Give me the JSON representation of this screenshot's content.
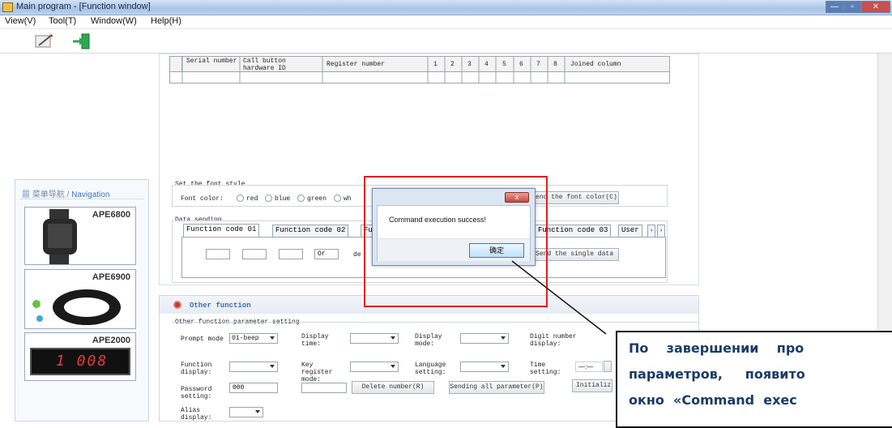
{
  "window": {
    "title": "Main program - [Function window]",
    "min": "—",
    "max": "▫",
    "close": "✕"
  },
  "menu": [
    "View(V)",
    "Tool(T)",
    "Window(W)",
    "Help(H)"
  ],
  "nav": {
    "title_cn": "菜单导航",
    "title_en": "Navigation",
    "products": [
      "APE6800",
      "APE6900",
      "APE2000"
    ],
    "display_value": "1 008"
  },
  "table": {
    "headers": [
      "Serial number",
      "Call button hardware ID",
      "Register number",
      "1",
      "2",
      "3",
      "4",
      "5",
      "6",
      "7",
      "8",
      "Joined column"
    ]
  },
  "font_style": {
    "title": "Set the font style",
    "label": "Font color:",
    "options": [
      "red",
      "blue",
      "green",
      "wh"
    ],
    "button": "Send the font color(C)"
  },
  "data_sending": {
    "title": "Data sending",
    "tabs": [
      "Function code 01",
      "Function code 02",
      "Fu",
      "Function code 03",
      "User"
    ],
    "field_or": "Or",
    "field_de": "de",
    "button": "Send the single data"
  },
  "dialog": {
    "message": "Command execution success!",
    "ok": "确定",
    "close": "x"
  },
  "other": {
    "title": "Other function",
    "group": "Other function parameter setting",
    "prompt_mode_label": "Prompt mode",
    "prompt_mode_value": "01-beep",
    "display_time_label": "Display time:",
    "display_mode_label": "Display mode:",
    "digit_number_label": "Digit number display:",
    "function_display_label": "Function display:",
    "key_register_label": "Key register mode:",
    "language_label": "Language setting:",
    "time_setting_label": "Time setting:",
    "time_value": "—:—",
    "password_label": "Password setting:",
    "password_value": "000",
    "delete_button": "Delete number(R)",
    "send_all_button": "Sending all parameter(P)",
    "init_button": "Initializ",
    "alias_label": "Alias display:"
  },
  "callout": {
    "lines": [
      "По    завершении    про",
      "параметров,     появито",
      "окно  «Command  exec"
    ]
  }
}
